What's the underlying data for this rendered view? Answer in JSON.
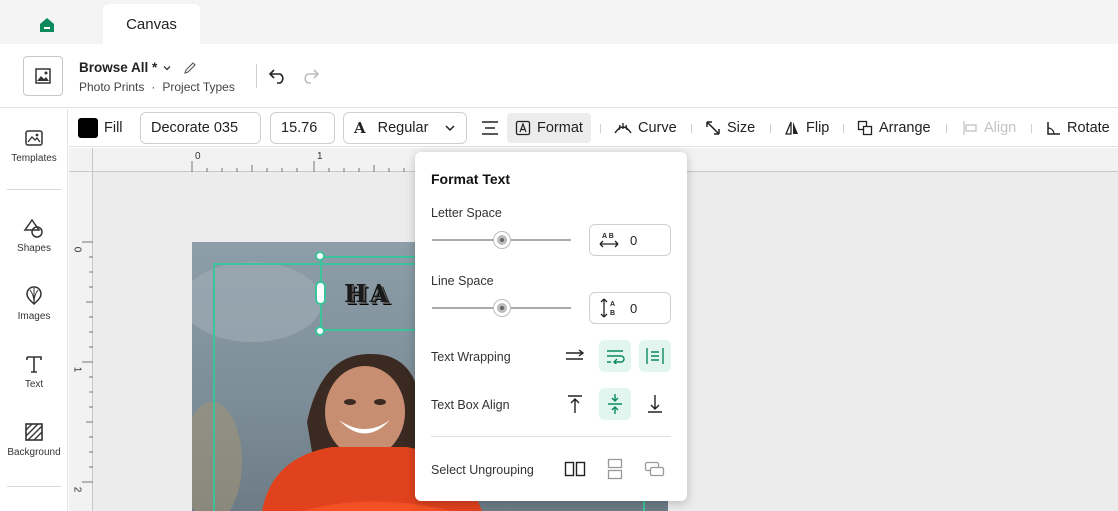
{
  "colors": {
    "accent": "#3cc39b",
    "brand": "#0b8a5e",
    "fill": "#000000"
  },
  "tabs": {
    "home_icon": "home-icon",
    "active_tab": "Canvas"
  },
  "header": {
    "project_name": "Browse All *",
    "breadcrumb": [
      "Photo Prints",
      "·",
      "Project Types"
    ]
  },
  "sidebar": {
    "items": [
      {
        "label": "Templates",
        "icon": "templates-icon"
      },
      {
        "label": "Shapes",
        "icon": "shapes-icon"
      },
      {
        "label": "Images",
        "icon": "images-icon"
      },
      {
        "label": "Text",
        "icon": "text-icon"
      },
      {
        "label": "Background",
        "icon": "background-icon"
      }
    ]
  },
  "toolbar": {
    "fill_label": "Fill",
    "font_name": "Decorate 035",
    "font_size": "15.76",
    "font_style": "Regular",
    "format_label": "Format",
    "curve_label": "Curve",
    "size_label": "Size",
    "flip_label": "Flip",
    "arrange_label": "Arrange",
    "align_label": "Align",
    "rotate_label": "Rotate"
  },
  "rulers": {
    "top": [
      "0",
      "1"
    ],
    "left": [
      "0",
      "1",
      "2"
    ]
  },
  "canvas": {
    "text": "HA"
  },
  "format_panel": {
    "title": "Format Text",
    "letter_space_label": "Letter Space",
    "letter_space_value": "0",
    "letter_space_level": 0.5,
    "line_space_label": "Line Space",
    "line_space_value": "0",
    "line_space_level": 0.5,
    "text_wrapping_label": "Text Wrapping",
    "text_box_align_label": "Text Box Align",
    "select_ungrouping_label": "Select Ungrouping"
  }
}
